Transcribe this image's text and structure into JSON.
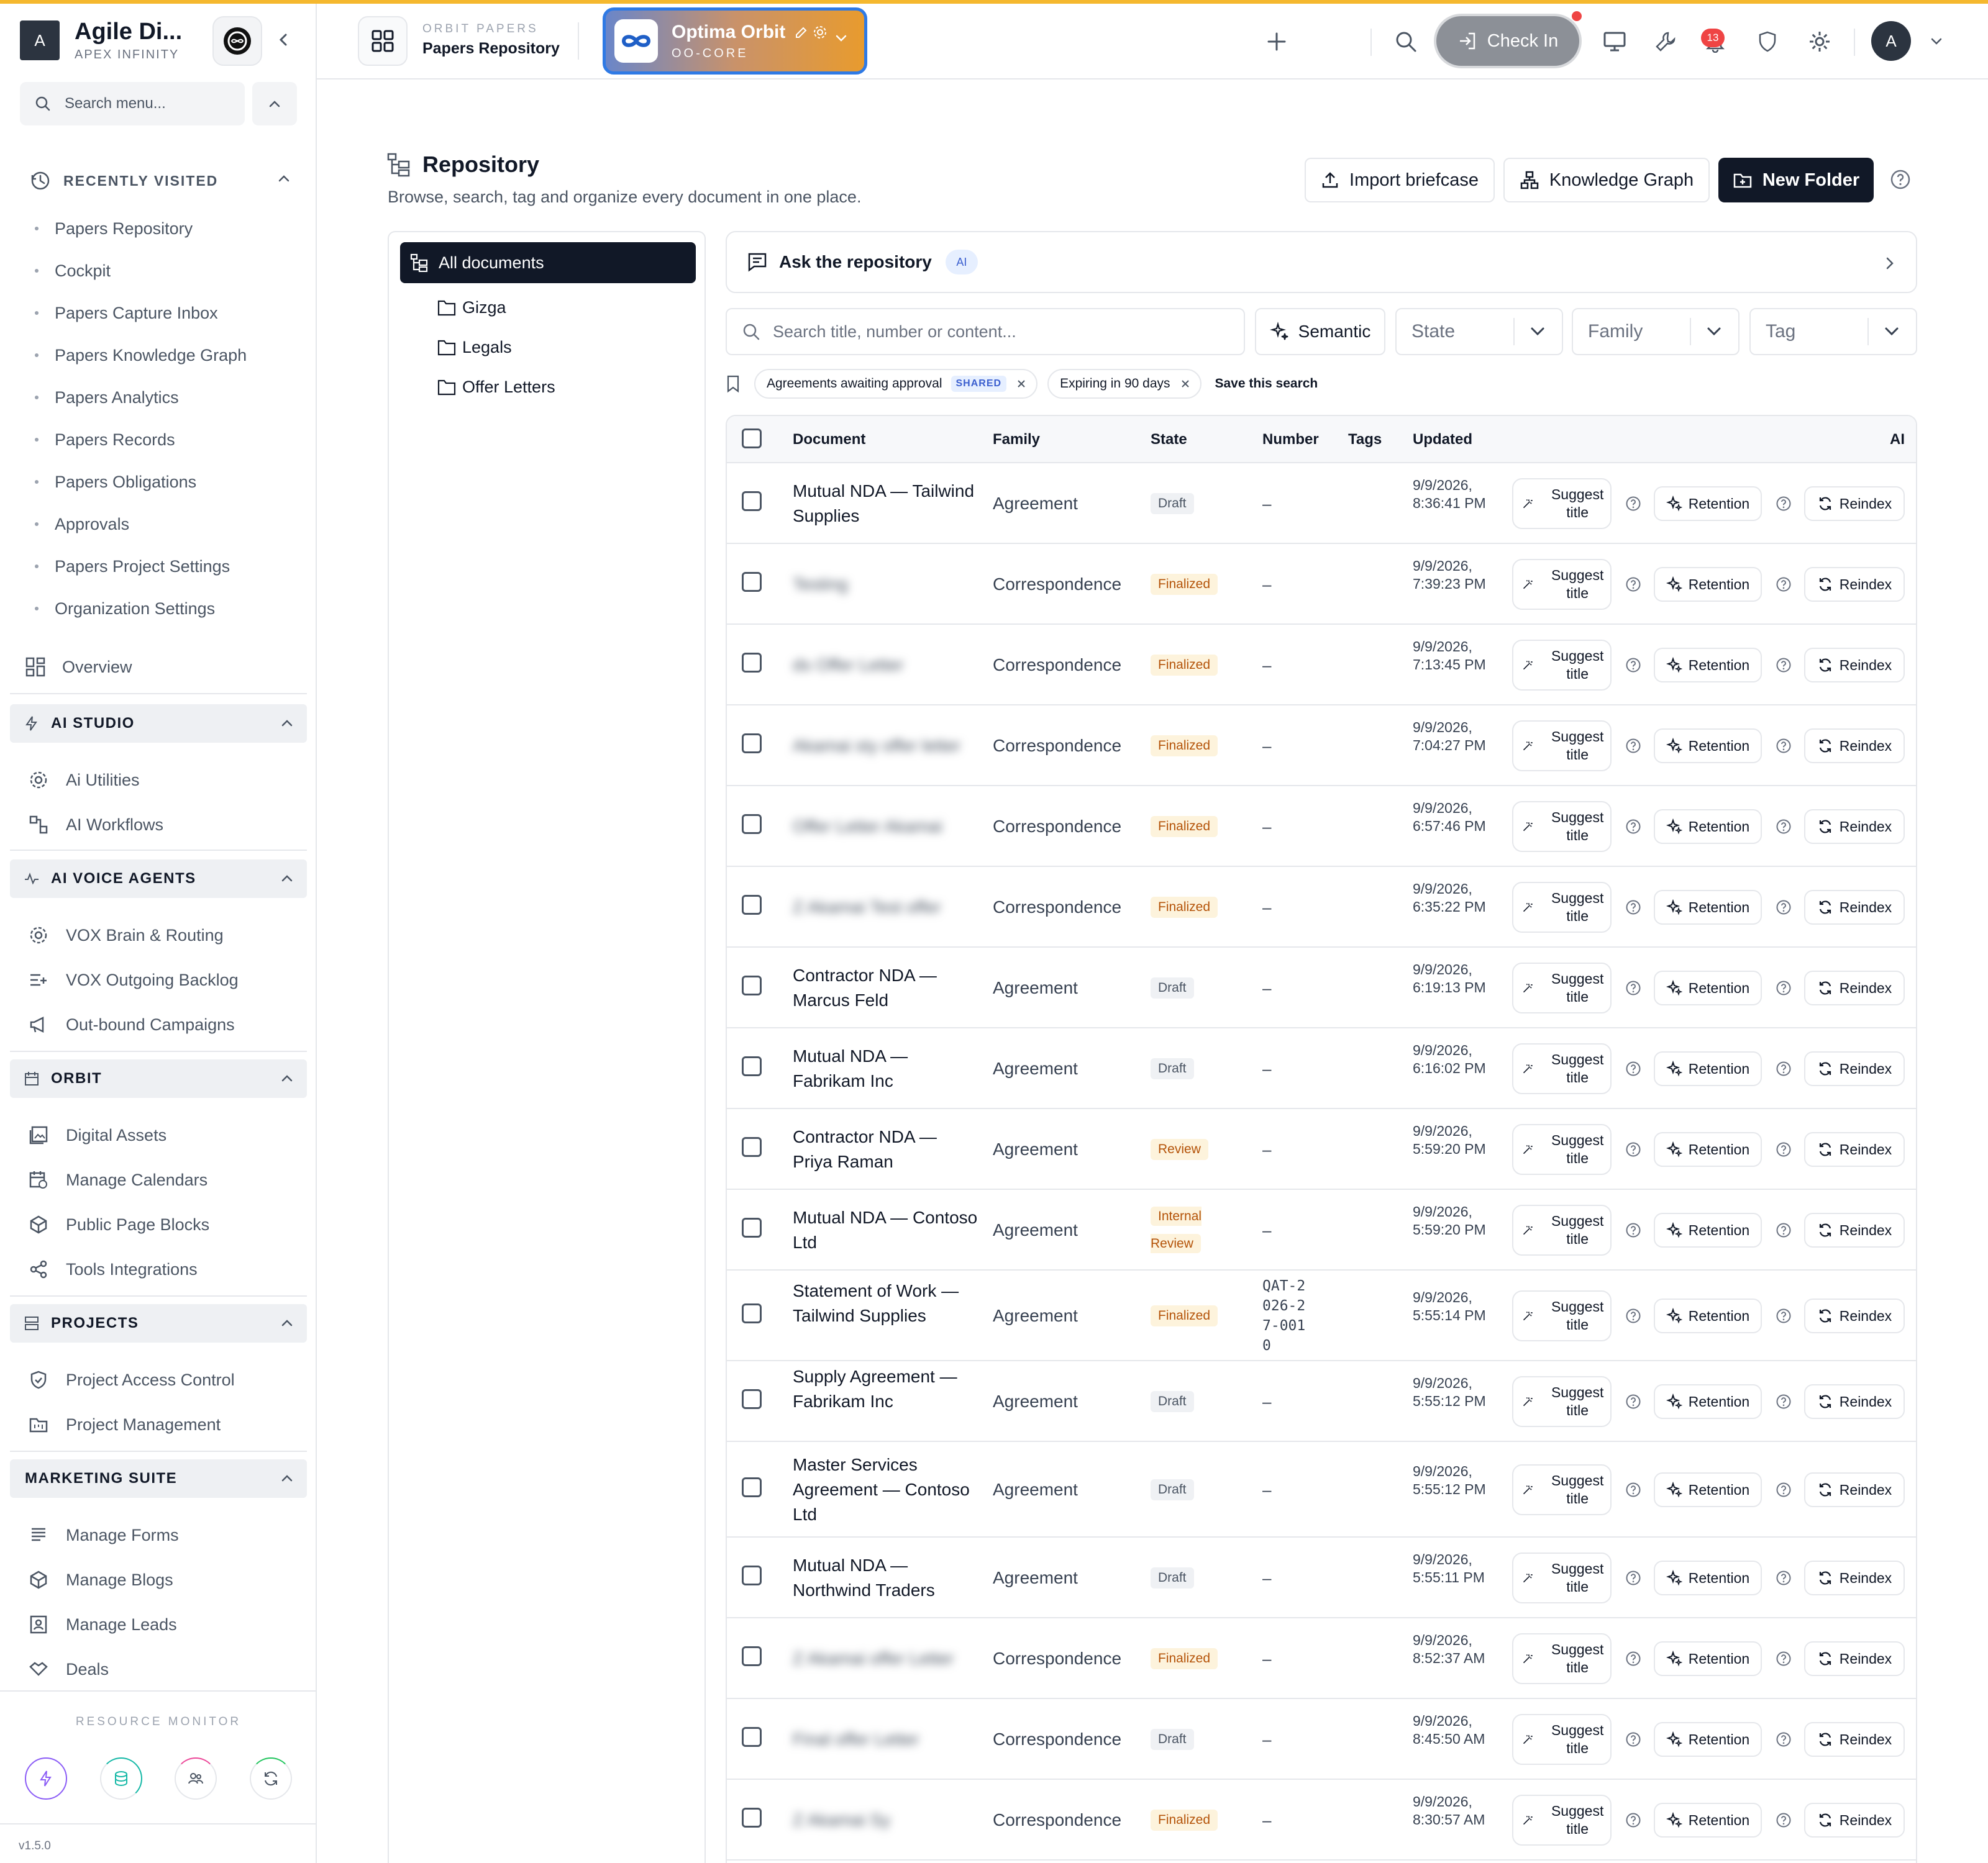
{
  "brand": {
    "initial": "A",
    "name": "Agile Di...",
    "subtitle": "APEX INFINITY"
  },
  "sidebar": {
    "search_placeholder": "Search menu...",
    "recently_visited": {
      "title": "RECENTLY VISITED",
      "items": [
        "Papers Repository",
        "Cockpit",
        "Papers Capture Inbox",
        "Papers Knowledge Graph",
        "Papers Analytics",
        "Papers Records",
        "Papers Obligations",
        "Approvals",
        "Papers Project Settings",
        "Organization Settings"
      ]
    },
    "overview": "Overview",
    "sections": [
      {
        "title": "AI STUDIO",
        "items": [
          "Ai Utilities",
          "AI Workflows"
        ]
      },
      {
        "title": "AI VOICE AGENTS",
        "items": [
          "VOX Brain & Routing",
          "VOX Outgoing Backlog",
          "Out-bound Campaigns"
        ]
      },
      {
        "title": "ORBIT",
        "items": [
          "Digital Assets",
          "Manage Calendars",
          "Public Page Blocks",
          "Tools Integrations"
        ]
      },
      {
        "title": "PROJECTS",
        "items": [
          "Project Access Control",
          "Project Management"
        ]
      },
      {
        "title": "MARKETING SUITE",
        "items": [
          "Manage Forms",
          "Manage Blogs",
          "Manage Leads",
          "Deals"
        ]
      }
    ],
    "resource_monitor": "RESOURCE MONITOR",
    "version": "v1.5.0"
  },
  "topbar": {
    "app_kicker": "ORBIT PAPERS",
    "app_name": "Papers Repository",
    "workspace_name": "Optima Orbit",
    "workspace_code": "OO-CORE",
    "check_in": "Check In",
    "notifications_count": "13",
    "avatar_initial": "A"
  },
  "page": {
    "title": "Repository",
    "subtitle": "Browse, search, tag and organize every document in one place.",
    "import_label": "Import briefcase",
    "graph_label": "Knowledge Graph",
    "new_folder_label": "New Folder"
  },
  "folders": {
    "all": "All documents",
    "items": [
      "Gizga",
      "Legals",
      "Offer Letters"
    ]
  },
  "ask": {
    "label": "Ask the repository",
    "badge": "AI"
  },
  "filters": {
    "search_placeholder": "Search title, number or content...",
    "semantic": "Semantic",
    "state": "State",
    "family": "Family",
    "tag": "Tag"
  },
  "saved_searches": [
    {
      "label": "Agreements awaiting approval",
      "badge": "SHARED"
    },
    {
      "label": "Expiring in 90 days",
      "badge": ""
    }
  ],
  "save_search_label": "Save this search",
  "table": {
    "columns": {
      "document": "Document",
      "family": "Family",
      "state": "State",
      "number": "Number",
      "tags": "Tags",
      "updated": "Updated",
      "ai": "AI"
    },
    "action_suggest": "Suggest title",
    "action_retention": "Retention",
    "action_reindex": "Reindex",
    "rows": [
      {
        "doc": "Mutual NDA — Tailwind Supplies",
        "blurred": false,
        "family": "Agreement",
        "state": "Draft",
        "number": "–",
        "updated": "9/9/2026, 8:36:41 PM"
      },
      {
        "doc": "Testing",
        "blurred": true,
        "family": "Correspondence",
        "state": "Finalized",
        "number": "–",
        "updated": "9/9/2026, 7:39:23 PM"
      },
      {
        "doc": "ds Offer Letter",
        "blurred": true,
        "family": "Correspondence",
        "state": "Finalized",
        "number": "–",
        "updated": "9/9/2026, 7:13:45 PM"
      },
      {
        "doc": "Akamai sty offer letter",
        "blurred": true,
        "family": "Correspondence",
        "state": "Finalized",
        "number": "–",
        "updated": "9/9/2026, 7:04:27 PM"
      },
      {
        "doc": "Offer Letter Akamai",
        "blurred": true,
        "family": "Correspondence",
        "state": "Finalized",
        "number": "–",
        "updated": "9/9/2026, 6:57:46 PM"
      },
      {
        "doc": "Z Akamai Test offer",
        "blurred": true,
        "family": "Correspondence",
        "state": "Finalized",
        "number": "–",
        "updated": "9/9/2026, 6:35:22 PM"
      },
      {
        "doc": "Contractor NDA — Marcus Feld",
        "blurred": false,
        "family": "Agreement",
        "state": "Draft",
        "number": "–",
        "updated": "9/9/2026, 6:19:13 PM"
      },
      {
        "doc": "Mutual NDA — Fabrikam Inc",
        "blurred": false,
        "family": "Agreement",
        "state": "Draft",
        "number": "–",
        "updated": "9/9/2026, 6:16:02 PM"
      },
      {
        "doc": "Contractor NDA — Priya Raman",
        "blurred": false,
        "family": "Agreement",
        "state": "Review",
        "number": "–",
        "updated": "9/9/2026, 5:59:20 PM"
      },
      {
        "doc": "Mutual NDA — Contoso Ltd",
        "blurred": false,
        "family": "Agreement",
        "state": "Internal Review",
        "number": "–",
        "updated": "9/9/2026, 5:59:20 PM"
      },
      {
        "doc": "Statement of Work — Tailwind Supplies",
        "blurred": false,
        "family": "Agreement",
        "state": "Finalized",
        "number": "QAT-2026-27-0010",
        "updated": "9/9/2026, 5:55:14 PM"
      },
      {
        "doc": "Supply Agreement — Fabrikam Inc",
        "blurred": false,
        "family": "Agreement",
        "state": "Draft",
        "number": "–",
        "updated": "9/9/2026, 5:55:12 PM"
      },
      {
        "doc": "Master Services Agreement — Contoso Ltd",
        "blurred": false,
        "family": "Agreement",
        "state": "Draft",
        "number": "–",
        "updated": "9/9/2026, 5:55:12 PM"
      },
      {
        "doc": "Mutual NDA — Northwind Traders",
        "blurred": false,
        "family": "Agreement",
        "state": "Draft",
        "number": "–",
        "updated": "9/9/2026, 5:55:11 PM"
      },
      {
        "doc": "Z Akamai offer Letter",
        "blurred": true,
        "family": "Correspondence",
        "state": "Finalized",
        "number": "–",
        "updated": "9/9/2026, 8:52:37 AM"
      },
      {
        "doc": "Final offer Letter",
        "blurred": true,
        "family": "Correspondence",
        "state": "Draft",
        "number": "–",
        "updated": "9/9/2026, 8:45:50 AM"
      },
      {
        "doc": "Z Akamai Sy",
        "blurred": true,
        "family": "Correspondence",
        "state": "Finalized",
        "number": "–",
        "updated": "9/9/2026, 8:30:57 AM"
      }
    ]
  }
}
